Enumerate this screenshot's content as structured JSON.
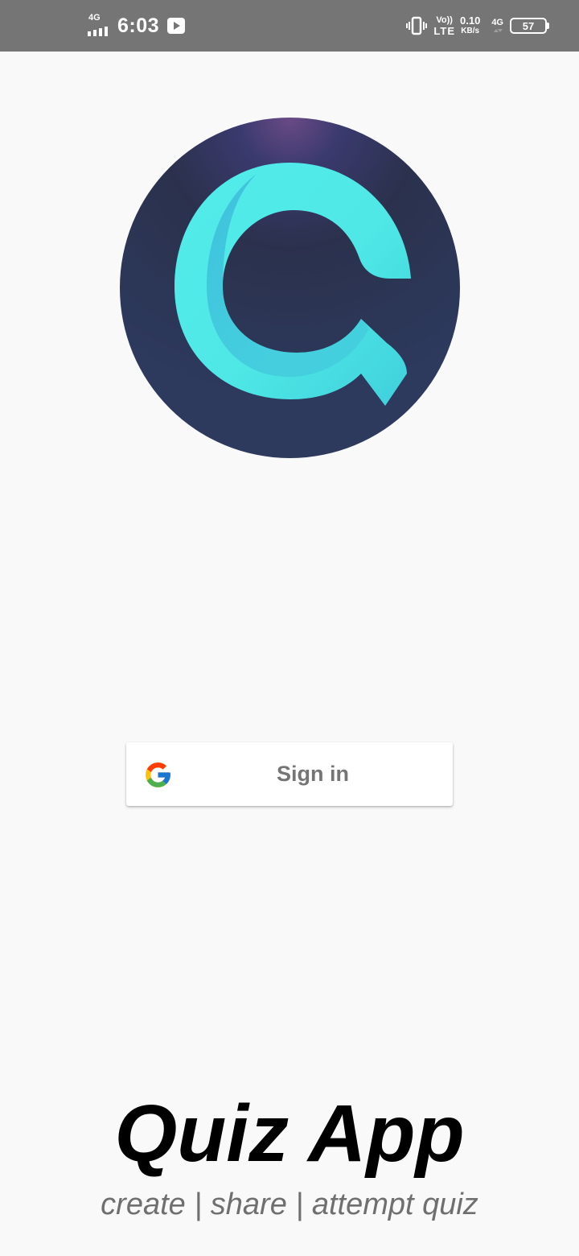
{
  "status_bar": {
    "signal_label": "4G",
    "time": "6:03",
    "volte_top": "Vo))",
    "volte_bottom": "LTE",
    "speed_value": "0.10",
    "speed_unit": "KB/s",
    "network_label": "4G",
    "battery": "57",
    "icons": {
      "signal": "signal-bars-icon",
      "youtube": "youtube-notification-icon",
      "vibrate": "vibrate-icon",
      "battery": "battery-icon"
    }
  },
  "logo": {
    "icon": "quiz-app-logo-icon",
    "colors": {
      "circle": "#2c3350",
      "accent": "#4ff0e6"
    }
  },
  "signin": {
    "label": "Sign in",
    "icon": "google-icon"
  },
  "app": {
    "title": "Quiz App",
    "tagline": "create | share | attempt quiz"
  },
  "colors": {
    "background": "#f9f9f9",
    "status_bar": "#757575",
    "button_text": "#757575",
    "title": "#000000",
    "tagline": "#6f6f6f"
  }
}
